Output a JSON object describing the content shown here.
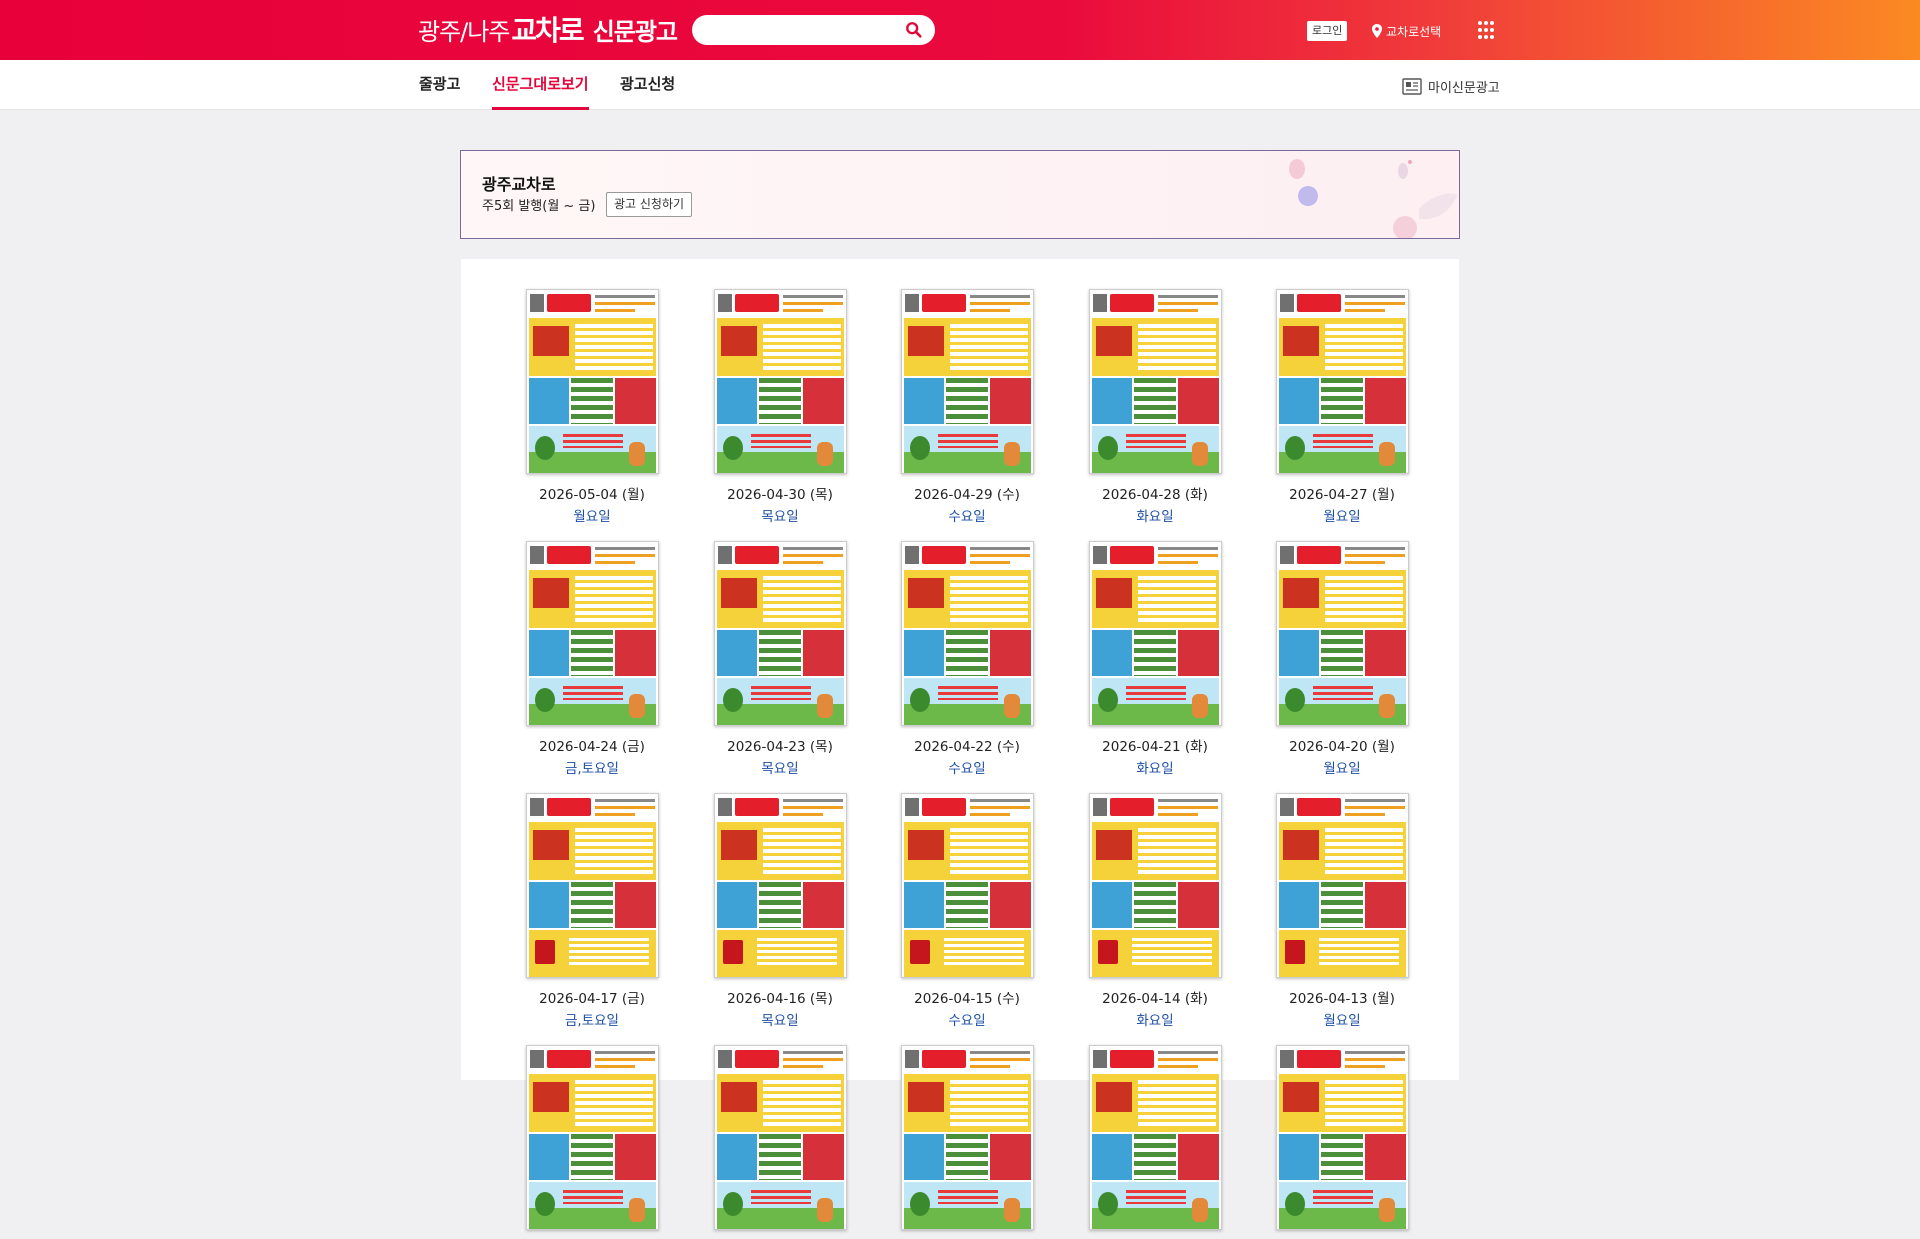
{
  "header": {
    "logo_city": "광주/나주",
    "logo_brand": "교차로",
    "logo_suffix": "신문광고",
    "search_placeholder": "",
    "login_label": "로그인",
    "location_label": "교차로선택",
    "accent_color": "#e4053b"
  },
  "nav": {
    "tabs": [
      {
        "label": "줄광고",
        "active": false
      },
      {
        "label": "신문그대로보기",
        "active": true
      },
      {
        "label": "광고신청",
        "active": false
      }
    ],
    "my_ad_label": "마이신문광고"
  },
  "banner": {
    "title": "광주교차로",
    "subtitle": "주5회 발행(월 ~ 금)",
    "apply_label": "광고 신청하기"
  },
  "issues": [
    {
      "date": "2026-05-04 (월)",
      "day": "월요일",
      "variant": "a"
    },
    {
      "date": "2026-04-30 (목)",
      "day": "목요일",
      "variant": "a"
    },
    {
      "date": "2026-04-29 (수)",
      "day": "수요일",
      "variant": "a"
    },
    {
      "date": "2026-04-28 (화)",
      "day": "화요일",
      "variant": "a"
    },
    {
      "date": "2026-04-27 (월)",
      "day": "월요일",
      "variant": "a"
    },
    {
      "date": "2026-04-24 (금)",
      "day": "금,토요일",
      "variant": "a"
    },
    {
      "date": "2026-04-23 (목)",
      "day": "목요일",
      "variant": "a"
    },
    {
      "date": "2026-04-22 (수)",
      "day": "수요일",
      "variant": "a"
    },
    {
      "date": "2026-04-21 (화)",
      "day": "화요일",
      "variant": "a"
    },
    {
      "date": "2026-04-20 (월)",
      "day": "월요일",
      "variant": "a"
    },
    {
      "date": "2026-04-17 (금)",
      "day": "금,토요일",
      "variant": "b"
    },
    {
      "date": "2026-04-16 (목)",
      "day": "목요일",
      "variant": "b"
    },
    {
      "date": "2026-04-15 (수)",
      "day": "수요일",
      "variant": "b"
    },
    {
      "date": "2026-04-14 (화)",
      "day": "화요일",
      "variant": "b"
    },
    {
      "date": "2026-04-13 (월)",
      "day": "월요일",
      "variant": "b"
    },
    {
      "date": "",
      "day": "",
      "variant": "a"
    },
    {
      "date": "",
      "day": "",
      "variant": "a"
    },
    {
      "date": "",
      "day": "",
      "variant": "a"
    },
    {
      "date": "",
      "day": "",
      "variant": "a"
    },
    {
      "date": "",
      "day": "",
      "variant": "a"
    }
  ]
}
